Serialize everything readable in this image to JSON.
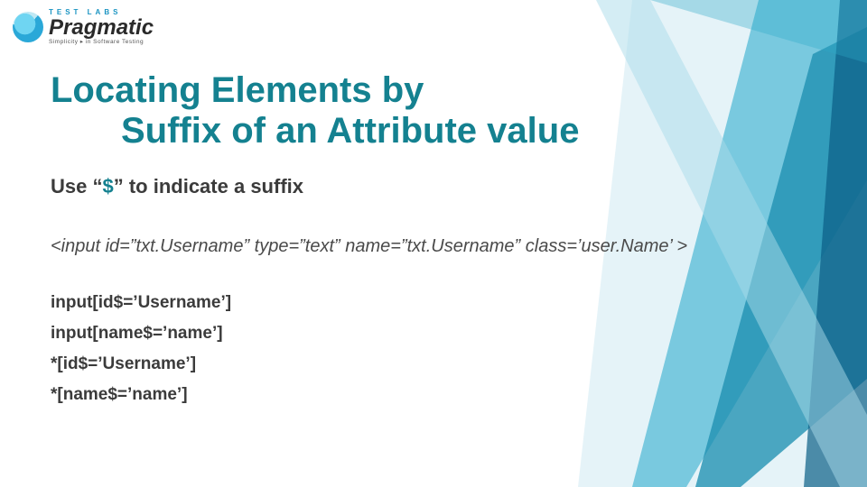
{
  "logo": {
    "sup": "TEST  LABS",
    "main": "Pragmatic",
    "sub": "Simplicity ▸ in Software Testing"
  },
  "title": {
    "line1": "Locating Elements by",
    "line2": "Suffix of an Attribute value"
  },
  "subtitle": {
    "pre": "Use “",
    "symbol": "$",
    "post": "” to indicate a suffix"
  },
  "html_snippet": "<input id=”txt.Username” type=”text” name=”txt.Username” class=’user.Name’ >",
  "selectors": [
    "input[id$=’Username’]",
    "input[name$=’name’]",
    "*[id$=’Username’]",
    "*[name$=’name’]"
  ]
}
